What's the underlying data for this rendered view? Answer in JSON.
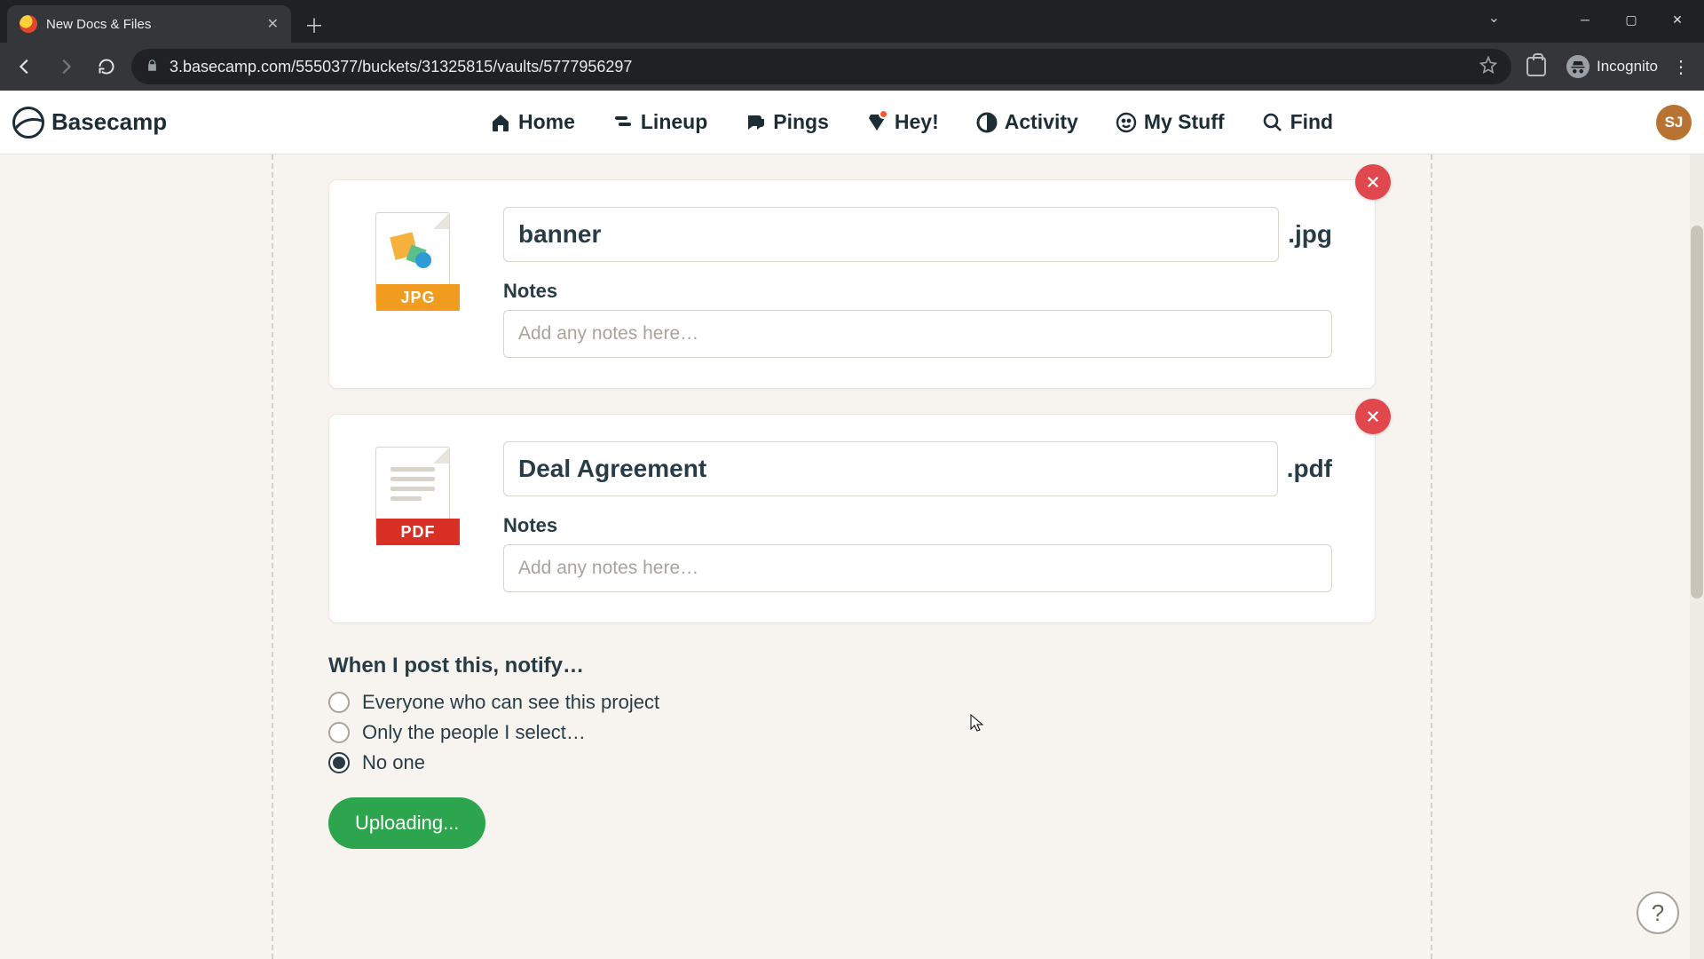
{
  "browser": {
    "tab_title": "New Docs & Files",
    "url": "3.basecamp.com/5550377/buckets/31325815/vaults/5777956297",
    "incognito_label": "Incognito"
  },
  "brand": "Basecamp",
  "nav": {
    "home": "Home",
    "lineup": "Lineup",
    "pings": "Pings",
    "hey": "Hey!",
    "activity": "Activity",
    "mystuff": "My Stuff",
    "find": "Find"
  },
  "avatar_initials": "SJ",
  "files": [
    {
      "name": "banner",
      "ext": ".jpg",
      "badge": "JPG",
      "notes_label": "Notes",
      "notes_placeholder": "Add any notes here…"
    },
    {
      "name": "Deal Agreement",
      "ext": ".pdf",
      "badge": "PDF",
      "notes_label": "Notes",
      "notes_placeholder": "Add any notes here…"
    }
  ],
  "notify": {
    "heading": "When I post this, notify…",
    "options": {
      "everyone": "Everyone who can see this project",
      "select": "Only the people I select…",
      "noone": "No one"
    },
    "selected": "noone"
  },
  "submit_label": "Uploading...",
  "help_label": "?"
}
